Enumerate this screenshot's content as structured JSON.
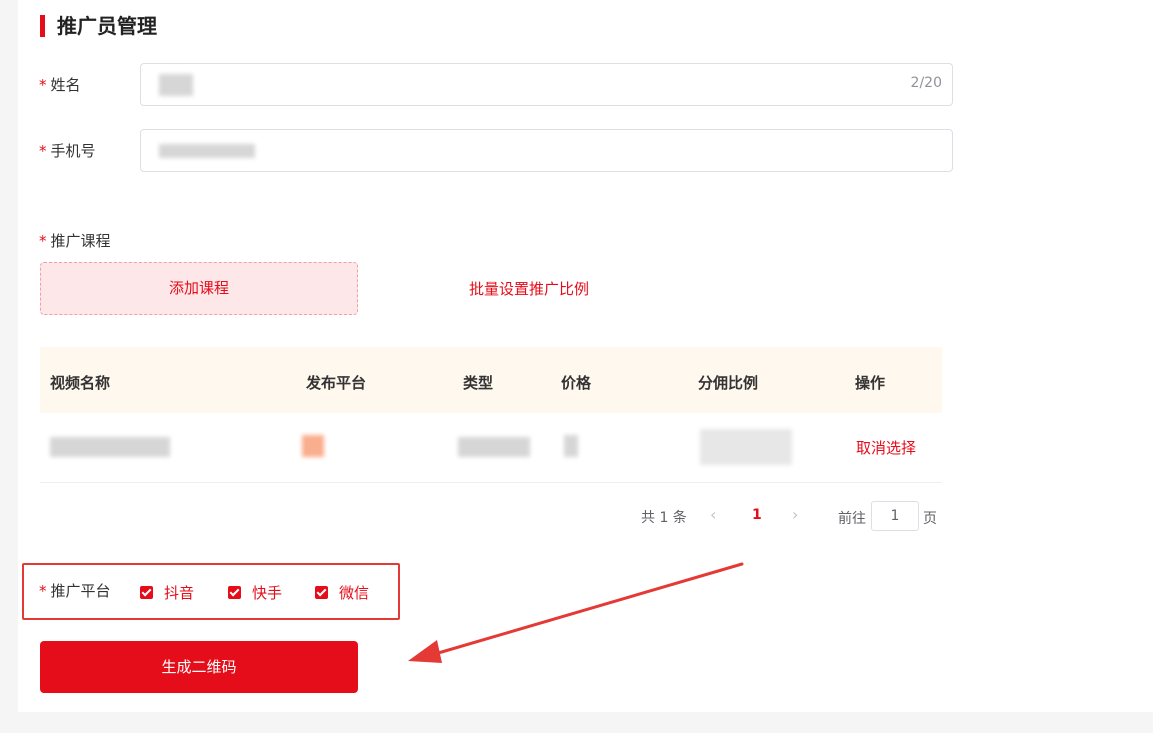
{
  "page": {
    "title": "推广员管理"
  },
  "form": {
    "name_label": "姓名",
    "name_counter": "2/20",
    "phone_label": "手机号",
    "course_label": "推广课程",
    "add_course": "添加课程",
    "batch_set": "批量设置推广比例",
    "required_mark": "*"
  },
  "table": {
    "headers": [
      "视频名称",
      "发布平台",
      "类型",
      "价格",
      "分佣比例",
      "操作"
    ],
    "rows": [
      {
        "action": "取消选择"
      }
    ]
  },
  "pagination": {
    "total": "共 1 条",
    "current_page": "1",
    "goto_label": "前往",
    "goto_value": "1",
    "page_suffix": "页"
  },
  "platform": {
    "label": "推广平台",
    "options": [
      {
        "label": "抖音",
        "checked": true
      },
      {
        "label": "快手",
        "checked": true
      },
      {
        "label": "微信",
        "checked": true
      }
    ]
  },
  "actions": {
    "generate": "生成二维码"
  },
  "colors": {
    "accent": "#e50d1a",
    "annotation": "#e53935",
    "table_header_bg": "#fff8ee",
    "add_btn_bg": "#fde7e8"
  }
}
